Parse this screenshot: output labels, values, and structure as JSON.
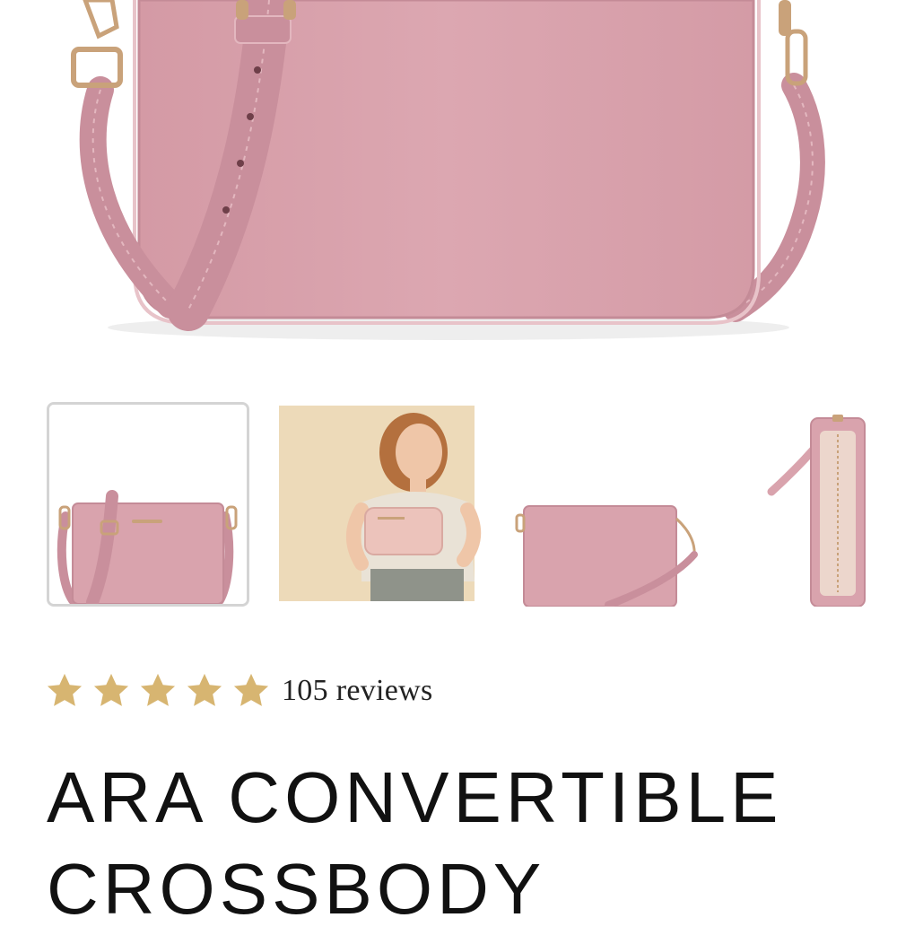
{
  "gallery": {
    "thumbnails": [
      {
        "name": "front-view",
        "selected": true
      },
      {
        "name": "model-holding-clutch",
        "selected": false
      },
      {
        "name": "clutch-with-wristlet",
        "selected": false
      },
      {
        "name": "open-interior-view",
        "selected": false
      }
    ]
  },
  "colors": {
    "bag_pink": "#d9a3ad",
    "strap_pink": "#c9909d",
    "hardware_gold": "#c9a27a",
    "star_gold": "#d7b571",
    "thumb_bg": "#eddab9"
  },
  "product": {
    "rating": 5,
    "reviews_label": "105 reviews",
    "title_line1": "ARA CONVERTIBLE",
    "title_line2": "CROSSBODY"
  }
}
